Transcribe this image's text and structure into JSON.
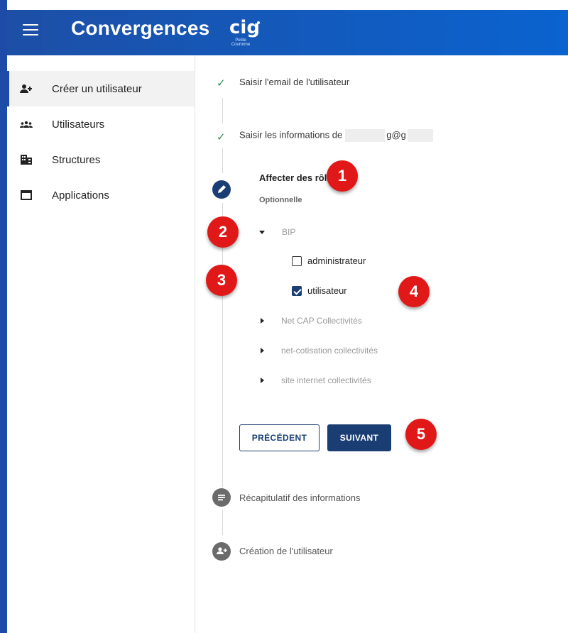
{
  "topbar": {
    "menu_icon": "hamburger-menu-icon",
    "brand": "Convergences",
    "logo_text": "cig",
    "logo_subtext": "Petite Couronne"
  },
  "sidebar": {
    "items": [
      {
        "label": "Créer un utilisateur",
        "icon": "add-user-icon",
        "active": true
      },
      {
        "label": "Utilisateurs",
        "icon": "users-group-icon",
        "active": false
      },
      {
        "label": "Structures",
        "icon": "building-icon",
        "active": false
      },
      {
        "label": "Applications",
        "icon": "window-icon",
        "active": false
      }
    ]
  },
  "stepper": {
    "step1": {
      "label": "Saisir l'email de l'utilisateur",
      "status": "done"
    },
    "step2": {
      "label_prefix": "Saisir les informations de",
      "email_visible_part": "g@g",
      "status": "done"
    },
    "step3": {
      "title": "Affecter des rôles",
      "subtitle": "Optionnelle",
      "status": "editing"
    },
    "tree": [
      {
        "label": "BIP",
        "expanded": true
      },
      {
        "label": "Net CAP Collectivités",
        "expanded": false
      },
      {
        "label": "net-cotisation collectivités",
        "expanded": false
      },
      {
        "label": "site internet collectivités",
        "expanded": false
      }
    ],
    "roles": [
      {
        "label": "administrateur",
        "checked": false
      },
      {
        "label": "utilisateur",
        "checked": true
      }
    ],
    "buttons": {
      "previous": "PRÉCÉDENT",
      "next": "SUIVANT"
    },
    "step4": {
      "label": "Récapitulatif des informations",
      "icon": "list-icon"
    },
    "step5": {
      "label": "Création de l'utilisateur",
      "icon": "add-user-icon"
    }
  },
  "annotations": [
    "1",
    "2",
    "3",
    "4",
    "5"
  ],
  "colors": {
    "accent": "#1a3e73",
    "topbar": "#0a63cf",
    "badge": "#e01818",
    "check": "#2e8b57"
  }
}
